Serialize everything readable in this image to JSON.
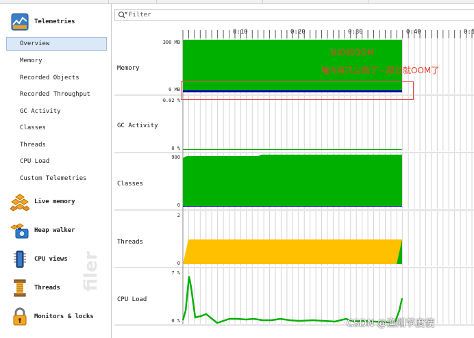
{
  "sidebar": {
    "sections": [
      {
        "label": "Telemetries",
        "icon": "telemetries-icon"
      },
      {
        "label": "Live memory",
        "icon": "live-memory-icon"
      },
      {
        "label": "Heap walker",
        "icon": "heap-walker-icon"
      },
      {
        "label": "CPU views",
        "icon": "cpu-views-icon"
      },
      {
        "label": "Threads",
        "icon": "threads-icon"
      },
      {
        "label": "Monitors & locks",
        "icon": "monitors-locks-icon"
      }
    ],
    "telemetry_items": [
      "Overview",
      "Memory",
      "Recorded Objects",
      "Recorded Throughput",
      "GC Activity",
      "Classes",
      "Threads",
      "CPU Load",
      "Custom Telemetries"
    ],
    "selected": "Overview",
    "watermark": "filer"
  },
  "filter": {
    "placeholder": "Filter"
  },
  "time_axis": {
    "ticks": [
      "0:10",
      "0:20",
      "0:30",
      "0:40",
      "0:5"
    ]
  },
  "telemetries": [
    {
      "name": "Memory",
      "top_label": "300 MB",
      "bottom_label": "0 MB"
    },
    {
      "name": "GC Activity",
      "top_label": "0.02 %",
      "bottom_label": "0 %"
    },
    {
      "name": "Classes",
      "top_label": "900",
      "bottom_label": "0"
    },
    {
      "name": "Threads",
      "top_label": "2",
      "bottom_label": "0"
    },
    {
      "name": "CPU Load",
      "top_label": "7 %",
      "bottom_label": "0 %"
    }
  ],
  "annotations": {
    "line1": "NIO的OOM",
    "line2": "堆内存只占用了一部分就OOM了"
  },
  "watermark": "CSDN @渔阳节度使",
  "colors": {
    "green": "#00b000",
    "yellow": "#ffc000",
    "blue": "#0000aa",
    "annotation": "#e8402c",
    "selection": "#dbe8f7"
  }
}
